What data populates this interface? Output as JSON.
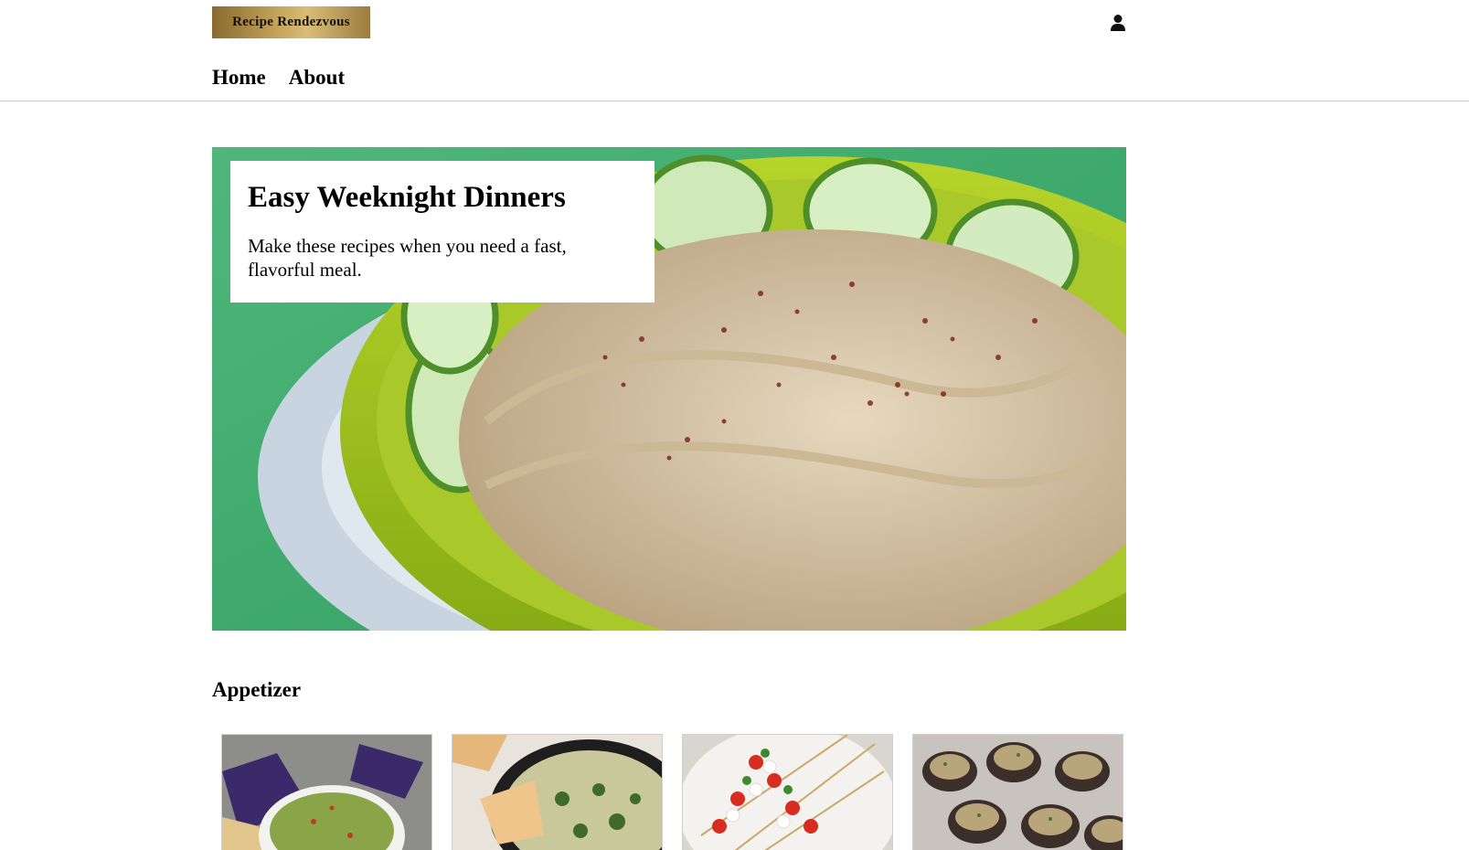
{
  "site": {
    "logo_text": "Recipe Rendezvous",
    "account_icon": "user-icon"
  },
  "nav": {
    "items": [
      {
        "label": "Home"
      },
      {
        "label": "About"
      }
    ]
  },
  "hero": {
    "title": "Easy Weeknight Dinners",
    "subtitle": "Make these recipes when you need a fast, flavorful meal.",
    "image_alt": "Hummus in a green bowl with cucumber slices"
  },
  "section": {
    "title": "Appetizer",
    "cards": [
      {
        "image_alt": "Guacamole with tortilla chips"
      },
      {
        "image_alt": "Spinach artichoke dip with chips"
      },
      {
        "image_alt": "Caprese skewers"
      },
      {
        "image_alt": "Stuffed mushrooms"
      }
    ]
  },
  "colors": {
    "logo_gold": "#c9a85e",
    "divider": "#cfcfcf"
  }
}
